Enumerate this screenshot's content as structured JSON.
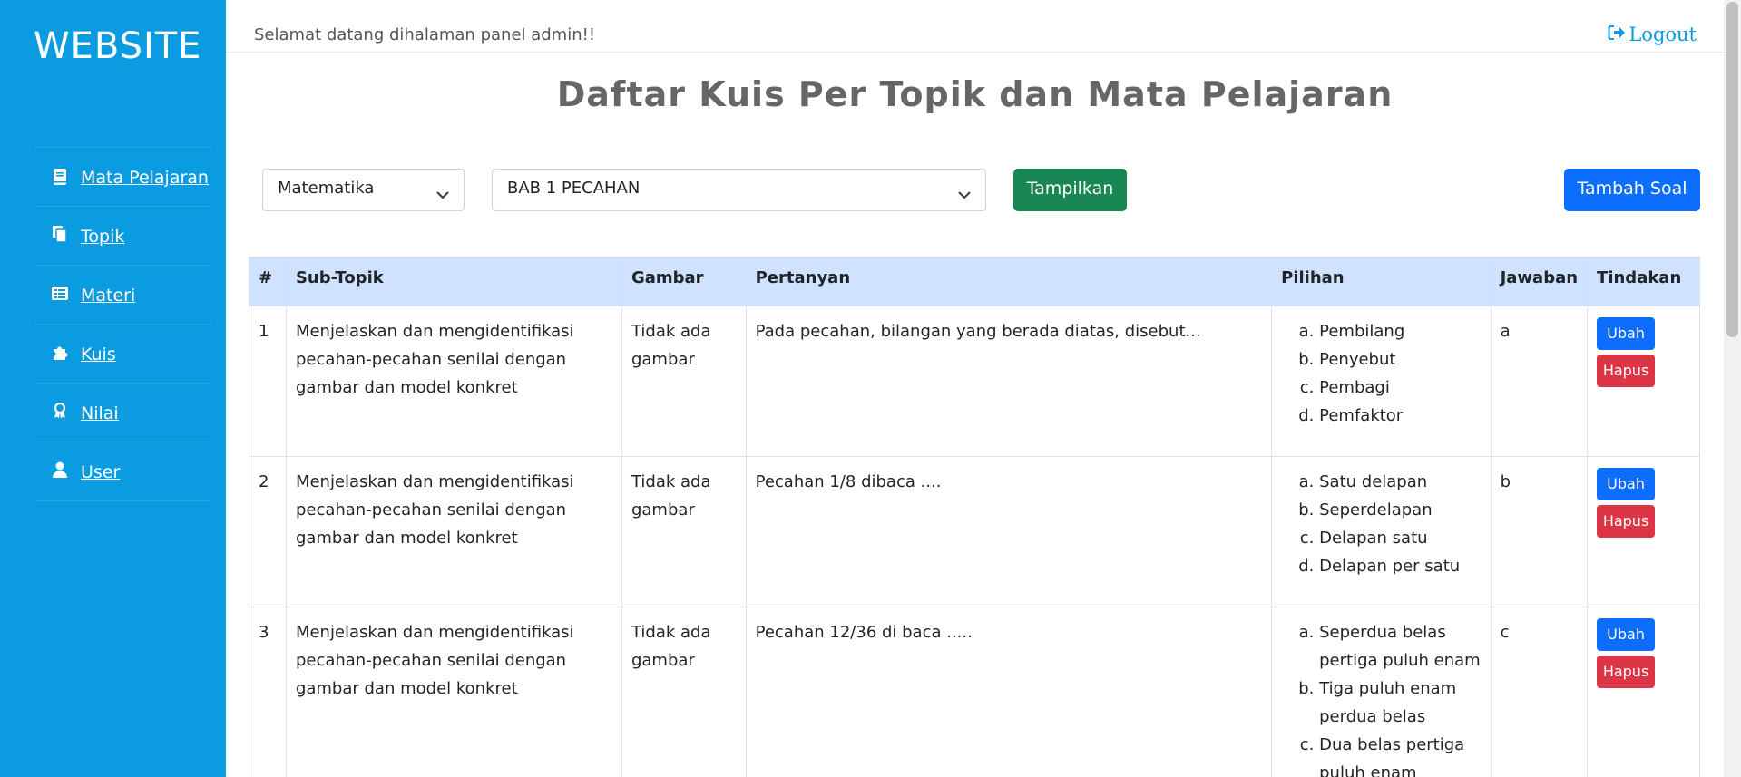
{
  "brand": "WEBSITE",
  "sidebar": {
    "items": [
      {
        "label": "Mata Pelajaran",
        "icon": "book-icon"
      },
      {
        "label": "Topik",
        "icon": "copy-icon"
      },
      {
        "label": "Materi",
        "icon": "list-alt-icon"
      },
      {
        "label": "Kuis",
        "icon": "puzzle-icon"
      },
      {
        "label": "Nilai",
        "icon": "award-icon"
      },
      {
        "label": "User",
        "icon": "user-icon"
      }
    ]
  },
  "topbar": {
    "welcome": "Selamat datang dihalaman panel admin!!",
    "logout_label": "Logout"
  },
  "page_title": "Daftar Kuis Per Topik dan Mata Pelajaran",
  "filters": {
    "subject_value": "Matematika",
    "topic_value": "BAB 1 PECAHAN",
    "show_label": "Tampilkan",
    "add_label": "Tambah Soal"
  },
  "table": {
    "headers": [
      "#",
      "Sub-Topik",
      "Gambar",
      "Pertanyan",
      "Pilihan",
      "Jawaban",
      "Tindakan"
    ],
    "rows": [
      {
        "no": "1",
        "subtopic": "Menjelaskan dan mengidentifikasi pecahan-pecahan senilai dengan gambar dan model konkret",
        "image": "Tidak ada gambar",
        "question": "Pada pecahan, bilangan yang berada diatas, disebut...",
        "options": [
          "Pembilang",
          "Penyebut",
          "Pembagi",
          "Pemfaktor"
        ],
        "answer": "a",
        "edit_label": "Ubah",
        "delete_label": "Hapus"
      },
      {
        "no": "2",
        "subtopic": "Menjelaskan dan mengidentifikasi pecahan-pecahan senilai dengan gambar dan model konkret",
        "image": "Tidak ada gambar",
        "question": "Pecahan 1/8 dibaca ....",
        "options": [
          "Satu delapan",
          "Seperdelapan",
          "Delapan satu",
          "Delapan per satu"
        ],
        "answer": "b",
        "edit_label": "Ubah",
        "delete_label": "Hapus"
      },
      {
        "no": "3",
        "subtopic": "Menjelaskan dan mengidentifikasi pecahan-pecahan senilai dengan gambar dan model konkret",
        "image": "Tidak ada gambar",
        "question": "Pecahan 12/36 di baca .....",
        "options": [
          "Seperdua belas pertiga puluh enam",
          "Tiga puluh enam perdua belas",
          "Dua belas pertiga puluh enam"
        ],
        "answer": "c",
        "edit_label": "Ubah",
        "delete_label": "Hapus"
      }
    ]
  },
  "colors": {
    "sidebar": "#0b9be0",
    "header_row": "#cfe2ff",
    "primary": "#0d6efd",
    "success": "#198754",
    "danger": "#dc3545"
  }
}
